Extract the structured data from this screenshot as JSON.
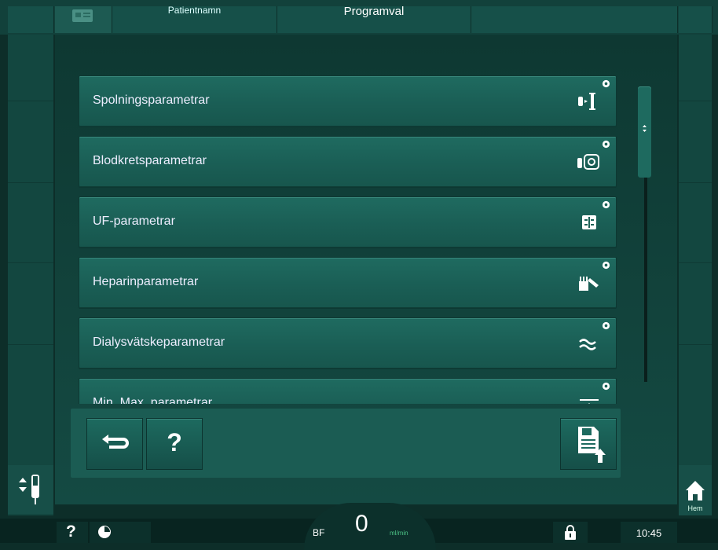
{
  "header": {
    "patient_label": "Patientnamn",
    "program_label": "Programval"
  },
  "menu": {
    "items": [
      {
        "label": "Spolningsparametrar",
        "icon": "rinse-icon"
      },
      {
        "label": "Blodkretsparametrar",
        "icon": "blood-circuit-icon"
      },
      {
        "label": "UF-parametrar",
        "icon": "uf-icon"
      },
      {
        "label": "Heparinparametrar",
        "icon": "heparin-icon"
      },
      {
        "label": "Dialysvätskeparametrar",
        "icon": "dialysate-icon"
      },
      {
        "label": "Min. Max. parametrar",
        "icon": "min-max-icon"
      }
    ],
    "settings_badge_icon": "gear-icon"
  },
  "toolbar": {
    "back_icon": "back-arrow-icon",
    "help_label": "?",
    "save_icon": "save-to-card-icon"
  },
  "sidebar": {
    "home_label": "Hem"
  },
  "statusbar": {
    "help_label": "?",
    "bf_label": "BF",
    "bf_value": "0",
    "bf_unit": "ml/min",
    "time": "10:45"
  },
  "colors": {
    "background": "#0d2e29",
    "button": "#1f6b60",
    "text": "#ffffff"
  }
}
